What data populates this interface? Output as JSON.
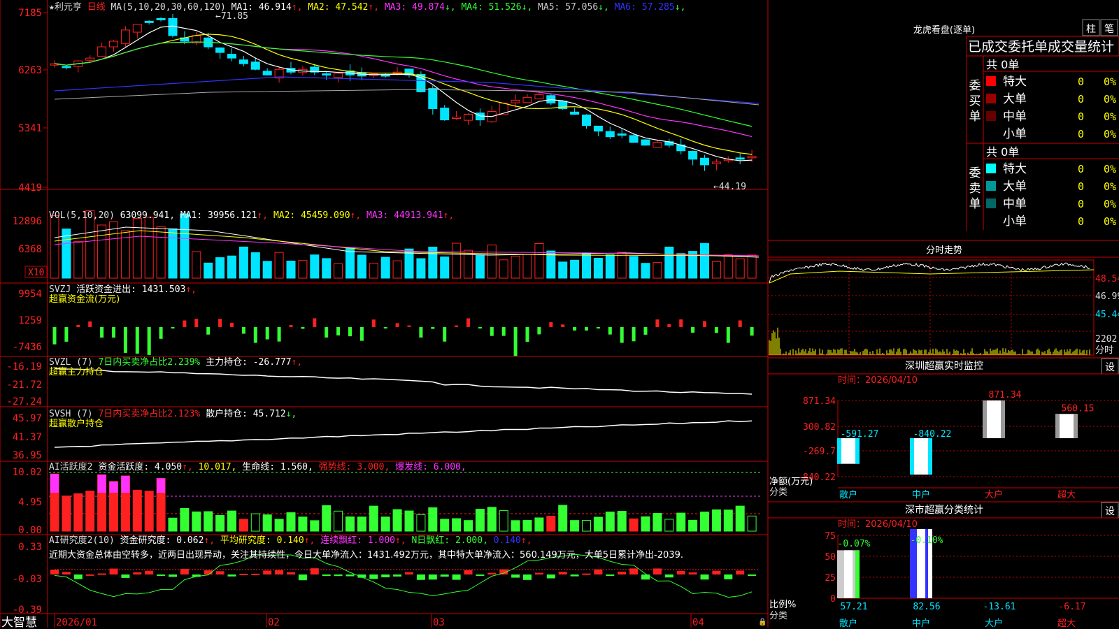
{
  "colors": {
    "up": "#ff2020",
    "down": "#00e5ff",
    "frame": "#cc0000",
    "yellow": "#ffff00",
    "white": "#ffffff",
    "magenta": "#ff33ff",
    "green": "#33ff33",
    "blue": "#3333ff"
  },
  "main": {
    "title_star": "★",
    "stock_name": "利元亨",
    "period": "日线",
    "ma_header": "MA(5,10,20,30,60,120)",
    "ma": [
      {
        "label": "MA1:",
        "value": "46.914",
        "arrow": "↑"
      },
      {
        "label": "MA2:",
        "value": "47.542",
        "arrow": "↑"
      },
      {
        "label": "MA3:",
        "value": "49.874",
        "arrow": "↓"
      },
      {
        "label": "MA4:",
        "value": "51.526",
        "arrow": "↓"
      },
      {
        "label": "MA5:",
        "value": "57.056",
        "arrow": "↓"
      },
      {
        "label": "MA6:",
        "value": "57.285",
        "arrow": "↓"
      }
    ],
    "yticks": [
      "7185",
      "6263",
      "5341",
      "4419"
    ],
    "high_marker": "71.85",
    "low_marker": "44.19",
    "x10": "X10"
  },
  "vol": {
    "header": "VOL(5,10,20)",
    "value": "63099.941",
    "ma": [
      {
        "label": "MA1:",
        "value": "39956.121",
        "arrow": "↑"
      },
      {
        "label": "MA2:",
        "value": "45459.090",
        "arrow": "↑"
      },
      {
        "label": "MA3:",
        "value": "44913.941",
        "arrow": "↑"
      }
    ],
    "yticks": [
      "12896",
      "6368"
    ]
  },
  "svzj": {
    "name": "SVZJ",
    "label": "活跃资金进出:",
    "value": "1431.503",
    "arrow": "↑",
    "sub": "超赢资金流(万元)",
    "yticks": [
      "9954",
      "1259",
      "-7436"
    ]
  },
  "svzl": {
    "name": "SVZL (7)",
    "label1": "7日内买卖净占比2.239%",
    "label2": "主力持仓:",
    "value": "-26.777",
    "arrow": "↑",
    "sub": "超赢主力持仓",
    "yticks": [
      "-16.19",
      "-21.72",
      "-27.24"
    ]
  },
  "svsh": {
    "name": "SVSH (7)",
    "label1": "7日内买卖净占比2.123%",
    "label2": "散户持仓:",
    "value": "45.712",
    "arrow": "↓",
    "sub": "超赢散户持仓",
    "yticks": [
      "45.97",
      "41.37",
      "36.95"
    ]
  },
  "ai1": {
    "name": "AI活跃度2",
    "label": "资金活跃度:",
    "value": "4.050",
    "arrow": "↑",
    "v2": "10.017",
    "l3": "生命线:",
    "v3": "1.560",
    "l4": "强势线:",
    "v4": "3.000",
    "l5": "爆发线:",
    "v5": "6.000",
    "yticks": [
      "10.02",
      "4.95",
      "0.00"
    ]
  },
  "ai2": {
    "name": "AI研究度2(10)",
    "label": "资金研究度:",
    "value": "0.062",
    "arrow": "↑",
    "l2": "平均研究度:",
    "v2": "0.140",
    "l3": "连续飘红:",
    "v3": "1.000",
    "l4": "N日飘红:",
    "v4": "2.000",
    "v5": "0.140",
    "comment": "近期大资金总体由空转多，近两日出现异动，关注其持续性，今日大单净流入：1431.492万元，其中特大单净流入：560.149万元，大单5日累计净出-2039.",
    "yticks": [
      "0.33",
      "-0.03",
      "-0.39"
    ]
  },
  "xaxis": {
    "brand": "大智慧",
    "labels": [
      "2026/01",
      "02",
      "03",
      "04"
    ]
  },
  "right": {
    "title": "龙虎看盘(逐单)",
    "btn_bar": "柱",
    "btn_stroke": "笔",
    "stats_title": "已成交委托单成交量统计",
    "buy": {
      "side": "委买单",
      "total": "共 0单",
      "rows": [
        {
          "name": "特大",
          "n": "0",
          "pct": "0%",
          "color": "#ff0000"
        },
        {
          "name": "大单",
          "n": "0",
          "pct": "0%",
          "color": "#990000"
        },
        {
          "name": "中单",
          "n": "0",
          "pct": "0%",
          "color": "#660000"
        },
        {
          "name": "小单",
          "n": "0",
          "pct": "0%",
          "color": ""
        }
      ]
    },
    "sell": {
      "side": "委卖单",
      "total": "共 0单",
      "rows": [
        {
          "name": "特大",
          "n": "0",
          "pct": "0%",
          "color": "#00ffff"
        },
        {
          "name": "大单",
          "n": "0",
          "pct": "0%",
          "color": "#009999"
        },
        {
          "name": "中单",
          "n": "0",
          "pct": "0%",
          "color": "#006666"
        },
        {
          "name": "小单",
          "n": "0",
          "pct": "0%",
          "color": ""
        }
      ]
    },
    "timeshare": {
      "title": "分时走势",
      "yticks": [
        "48.54",
        "46.99",
        "45.44"
      ],
      "vol_label": "2202",
      "vol_unit": "分时"
    },
    "monitor": {
      "title": "深圳超赢实时监控",
      "set": "设",
      "time": "时间：2026/04/10",
      "yticks": [
        "871.34",
        "300.82",
        "-269.7",
        "-840.22"
      ],
      "ylabel": "净额(万元)",
      "xlabel": "分类",
      "bars": [
        {
          "cat": "散户",
          "value": -591.27,
          "label": "-591.27"
        },
        {
          "cat": "中户",
          "value": -840.22,
          "label": "-840.22"
        },
        {
          "cat": "大户",
          "value": 871.34,
          "label": "871.34"
        },
        {
          "cat": "超大",
          "value": 560.15,
          "label": "560.15"
        }
      ]
    },
    "classify": {
      "title": "深市超赢分类统计",
      "set": "设",
      "time": "时间：2026/04/10",
      "yticks": [
        "75",
        "50",
        "25",
        "0"
      ],
      "ylabel": "比例%",
      "xlabel": "分类",
      "bars": [
        {
          "cat": "散户",
          "top": "-0.07%",
          "bottom": "57.21"
        },
        {
          "cat": "中户",
          "top": "-0.10%",
          "bottom": "82.56"
        },
        {
          "cat": "大户",
          "top": "",
          "bottom": "-13.61"
        },
        {
          "cat": "超大",
          "top": "",
          "bottom": "-6.17"
        }
      ]
    }
  }
}
